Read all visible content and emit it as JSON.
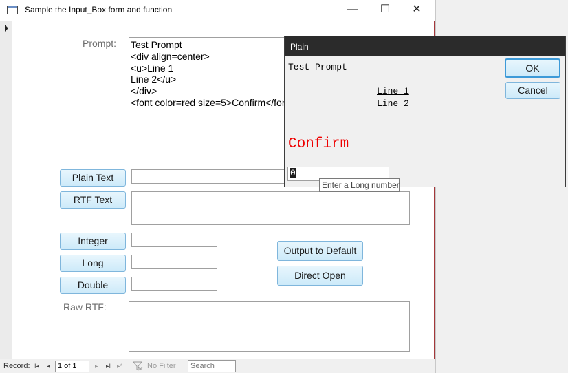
{
  "window": {
    "title": "Sample the Input_Box form and function",
    "minimize_glyph": "—",
    "maximize_glyph": "☐",
    "close_glyph": "✕"
  },
  "form": {
    "prompt_label": "Prompt:",
    "prompt_lines": [
      "Test Prompt",
      "<div align=center>",
      "<u>Line 1",
      "Line 2</u>",
      "</div>",
      "<font color=red size=5>Confirm</font>"
    ],
    "plain_text_button": "Plain Text",
    "rtf_text_button": "RTF Text",
    "integer_button": "Integer",
    "long_button": "Long",
    "double_button": "Double",
    "output_default_button": "Output to Default",
    "direct_open_button": "Direct Open",
    "raw_rtf_label": "Raw RTF:"
  },
  "statusbar": {
    "record_label": "Record:",
    "first_glyph": "I◂",
    "prev_glyph": "◂",
    "record_position": "1 of 1",
    "next_glyph": "▸",
    "last_glyph": "▸I",
    "new_glyph": "▸*",
    "filter_label": "No Filter",
    "search_placeholder": "Search"
  },
  "dialog": {
    "title": "Plain",
    "prompt_text": "Test Prompt",
    "line1": "Line 1",
    "line2": "Line 2",
    "confirm_text": "Confirm",
    "ok_button": "OK",
    "cancel_button": "Cancel",
    "input_value": "0",
    "tooltip": "Enter a Long number"
  },
  "colors": {
    "accent_border": "#a4373a",
    "confirm_red": "#ee0000",
    "button_blue": "#cdeaf9"
  }
}
